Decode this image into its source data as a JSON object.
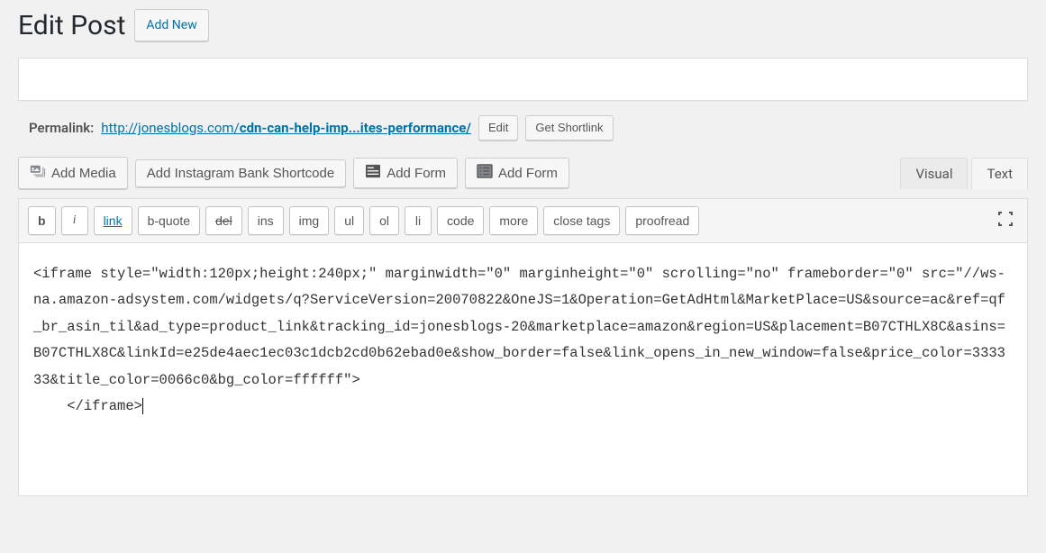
{
  "header": {
    "title": "Edit Post",
    "add_new": "Add New"
  },
  "title_field": {
    "value": "",
    "placeholder": ""
  },
  "permalink": {
    "label": "Permalink:",
    "base_url": "http://jonesblogs.com/",
    "slug": "cdn-can-help-imp...ites-performance/",
    "edit": "Edit",
    "shortlink": "Get Shortlink"
  },
  "media_buttons": {
    "add_media": "Add Media",
    "instagram": "Add Instagram Bank Shortcode",
    "add_form_1": "Add Form",
    "add_form_2": "Add Form"
  },
  "tabs": {
    "visual": "Visual",
    "text": "Text"
  },
  "quicktags": {
    "b": "b",
    "i": "i",
    "link": "link",
    "bquote": "b-quote",
    "del": "del",
    "ins": "ins",
    "img": "img",
    "ul": "ul",
    "ol": "ol",
    "li": "li",
    "code": "code",
    "more": "more",
    "close": "close tags",
    "proofread": "proofread"
  },
  "editor": {
    "content": "<iframe style=\"width:120px;height:240px;\" marginwidth=\"0\" marginheight=\"0\" scrolling=\"no\" frameborder=\"0\" src=\"//ws-na.amazon-adsystem.com/widgets/q?ServiceVersion=20070822&OneJS=1&Operation=GetAdHtml&MarketPlace=US&source=ac&ref=qf_br_asin_til&ad_type=product_link&tracking_id=jonesblogs-20&marketplace=amazon&region=US&placement=B07CTHLX8C&asins=B07CTHLX8C&linkId=e25de4aec1ec03c1dcb2cd0b62ebad0e&show_border=false&link_opens_in_new_window=false&price_color=333333&title_color=0066c0&bg_color=ffffff\">\n    </iframe>"
  }
}
